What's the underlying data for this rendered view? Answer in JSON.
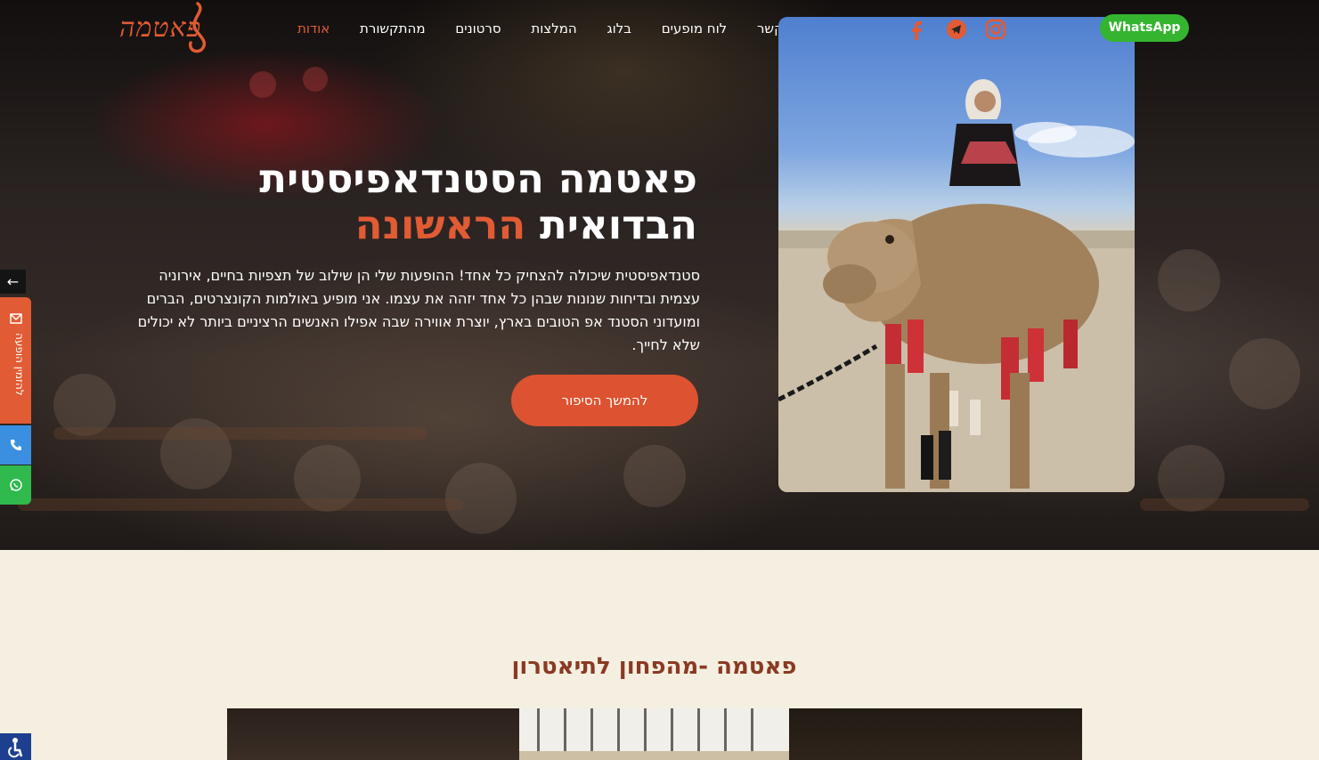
{
  "header": {
    "logo_text": "פאטמה",
    "nav": [
      "צור קשר",
      "לוח מופעים",
      "בלוג",
      "המלצות",
      "סרטונים",
      "מהתקשורת",
      "אודות"
    ],
    "active_nav": "אודות",
    "social_icons": [
      "instagram-icon",
      "telegram-icon",
      "facebook-icon"
    ],
    "whatsapp_label": "WhatsApp"
  },
  "hero": {
    "title_line1": "פאטמה הסטנדאפיסטית",
    "title_line2_plain": "הבדואית",
    "title_line2_accent": "הראשונה",
    "intro": "סטנדאפיסטית שיכולה להצחיק כל אחד! ההופעות שלי הן שילוב של תצפיות בחיים, אירוניה עצמית ובדיחות שנונות שבהן כל אחד יזהה את עצמו. אני מופיע באולמות הקונצרטים, הברים ומועדוני הסטנד אפ הטובים בארץ, יוצרת אווירה שבה אפילו האנשים הרציניים ביותר לא יכולים שלא לחייך.",
    "cta_label": "להמשך הסיפור"
  },
  "sidebar": {
    "arrow": "←",
    "book_label": "להזמין הופעה"
  },
  "section": {
    "title": "פאטמה -מהפחון לתיאטרון"
  },
  "colors": {
    "accent": "#e15b34",
    "whatsapp": "#34b42f",
    "section_bg": "#f4efe1",
    "section_title": "#8a3a22"
  }
}
